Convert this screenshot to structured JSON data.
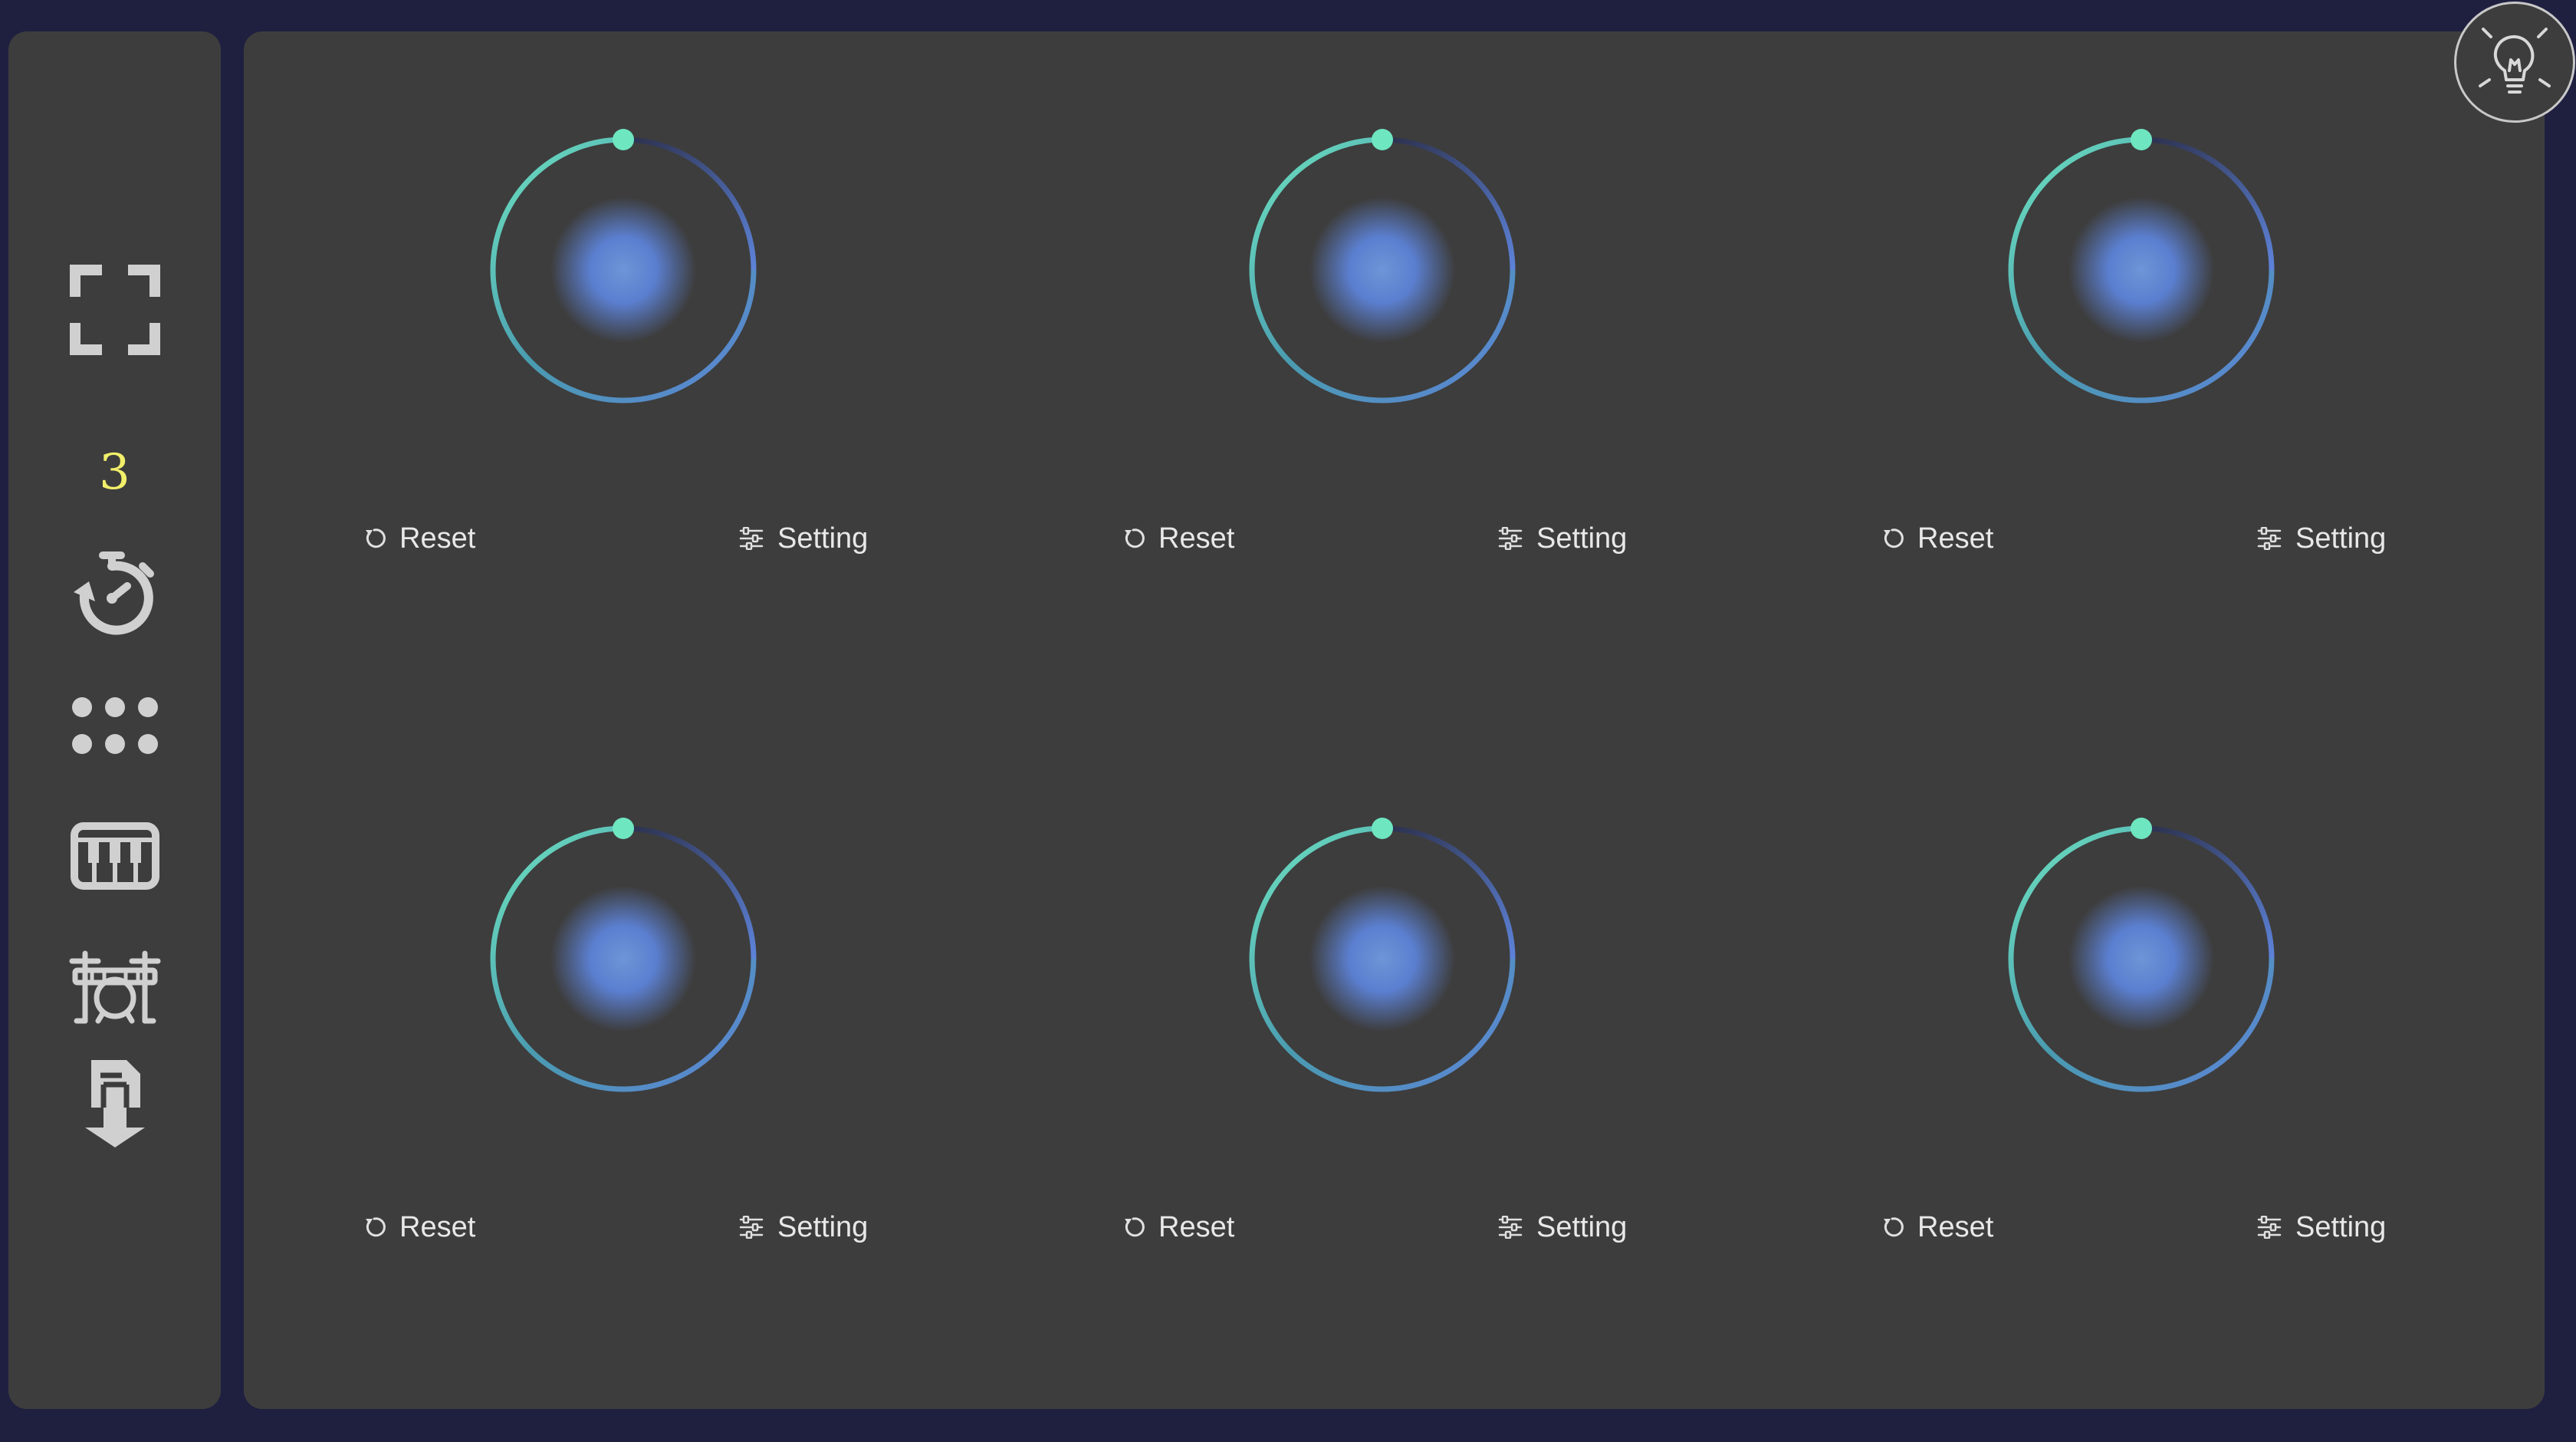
{
  "sidebar": {
    "icons": {
      "fullscreen": "fullscreen-icon",
      "timer": "timer-icon",
      "grid": "grid-icon",
      "piano": "piano-icon",
      "drums": "drum-kit-icon",
      "download": "download-icon"
    },
    "counter": "3",
    "counter_color": "#f2ef6a"
  },
  "hint_button": {
    "icon": "lightbulb-icon"
  },
  "dials": [
    {
      "reset_label": "Reset",
      "setting_label": "Setting"
    },
    {
      "reset_label": "Reset",
      "setting_label": "Setting"
    },
    {
      "reset_label": "Reset",
      "setting_label": "Setting"
    },
    {
      "reset_label": "Reset",
      "setting_label": "Setting"
    },
    {
      "reset_label": "Reset",
      "setting_label": "Setting"
    },
    {
      "reset_label": "Reset",
      "setting_label": "Setting"
    }
  ],
  "colors": {
    "page_background": "#1f2040",
    "panel_background": "#3d3d3d",
    "accent_teal": "#6ee6c0",
    "accent_blue": "#5d82d8",
    "icon_gray": "#d0d0d0",
    "text": "#e8e8e8"
  }
}
